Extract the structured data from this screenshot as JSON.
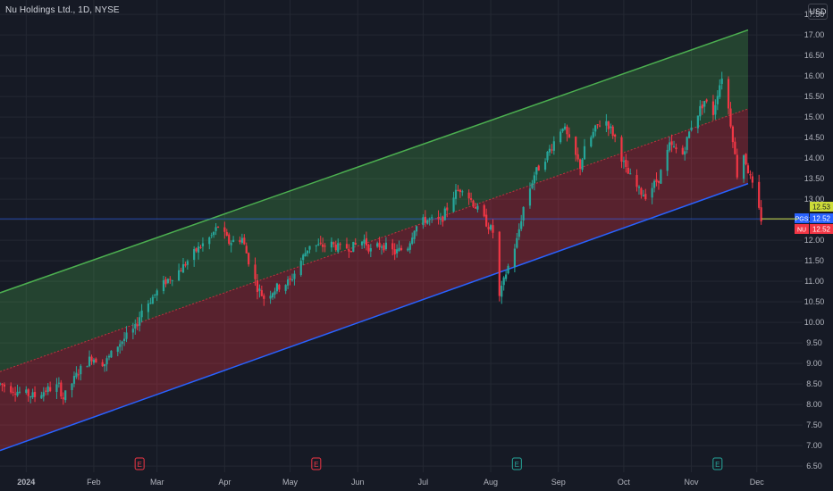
{
  "header": {
    "title": "Nu Holdings Ltd., 1D, NYSE",
    "currency": "USD"
  },
  "chart_data": {
    "type": "candlestick",
    "y_ticks": [
      "6.50",
      "7.00",
      "7.50",
      "8.00",
      "8.50",
      "9.00",
      "9.50",
      "10.00",
      "10.50",
      "11.00",
      "11.50",
      "12.00",
      "12.50",
      "13.00",
      "13.50",
      "14.00",
      "14.50",
      "15.00",
      "15.50",
      "16.00",
      "16.50",
      "17.00",
      "17.50"
    ],
    "ylim": [
      6.35,
      17.85
    ],
    "x_labels": [
      "2024",
      "Feb",
      "Mar",
      "Apr",
      "May",
      "Jun",
      "Jul",
      "Aug",
      "Sep",
      "Oct",
      "Nov",
      "Dec"
    ],
    "x_label_dates": [
      "2024-01-01",
      "2024-02-01",
      "2024-03-01",
      "2024-04-01",
      "2024-05-01",
      "2024-06-01",
      "2024-07-01",
      "2024-08-01",
      "2024-09-01",
      "2024-10-01",
      "2024-11-01",
      "2024-12-01"
    ],
    "xlim": [
      "2023-12-20",
      "2024-12-22"
    ],
    "regression_channel": {
      "start": "2023-12-20",
      "end": "2024-11-27",
      "upper": [
        10.72,
        17.12
      ],
      "middle": [
        8.8,
        15.2
      ],
      "lower": [
        6.88,
        13.38
      ]
    },
    "close_line_value": 12.52,
    "price_badges": [
      {
        "label": "12.53",
        "value": 12.53,
        "color": "#cddc39"
      },
      {
        "label": "12.52",
        "value": 12.52,
        "color": "#2962ff",
        "tag": "PGS"
      },
      {
        "label": "12.52",
        "value": 12.52,
        "color": "#f23645",
        "tag": "NU"
      }
    ],
    "earnings_dates": [
      "2024-02-22",
      "2024-05-13",
      "2024-08-13",
      "2024-11-13"
    ],
    "earnings_label": "E",
    "path_points": [
      [
        "2023-12-20",
        8.5
      ],
      [
        "2023-12-29",
        8.3
      ],
      [
        "2024-01-05",
        8.2
      ],
      [
        "2024-01-10",
        8.35
      ],
      [
        "2024-01-16",
        8.45
      ],
      [
        "2024-01-18",
        8.15
      ],
      [
        "2024-01-25",
        8.8
      ],
      [
        "2024-01-31",
        9.15
      ],
      [
        "2024-02-06",
        9.0
      ],
      [
        "2024-02-12",
        9.45
      ],
      [
        "2024-02-20",
        9.85
      ],
      [
        "2024-02-23",
        10.3
      ],
      [
        "2024-02-27",
        10.55
      ],
      [
        "2024-03-05",
        11.0
      ],
      [
        "2024-03-12",
        11.3
      ],
      [
        "2024-03-19",
        11.75
      ],
      [
        "2024-03-26",
        12.1
      ],
      [
        "2024-03-29",
        12.35
      ],
      [
        "2024-04-03",
        11.95
      ],
      [
        "2024-04-09",
        12.05
      ],
      [
        "2024-04-12",
        11.5
      ],
      [
        "2024-04-16",
        10.85
      ],
      [
        "2024-04-19",
        10.6
      ],
      [
        "2024-04-25",
        10.85
      ],
      [
        "2024-05-01",
        11.0
      ],
      [
        "2024-05-06",
        11.5
      ],
      [
        "2024-05-10",
        11.9
      ],
      [
        "2024-05-15",
        11.85
      ],
      [
        "2024-05-20",
        11.9
      ],
      [
        "2024-05-24",
        11.8
      ],
      [
        "2024-05-30",
        11.85
      ],
      [
        "2024-06-04",
        12.0
      ],
      [
        "2024-06-07",
        11.75
      ],
      [
        "2024-06-12",
        11.9
      ],
      [
        "2024-06-18",
        11.7
      ],
      [
        "2024-06-24",
        11.85
      ],
      [
        "2024-06-27",
        12.3
      ],
      [
        "2024-07-02",
        12.5
      ],
      [
        "2024-07-09",
        12.45
      ],
      [
        "2024-07-15",
        13.1
      ],
      [
        "2024-07-19",
        13.3
      ],
      [
        "2024-07-24",
        12.9
      ],
      [
        "2024-07-29",
        12.5
      ],
      [
        "2024-08-02",
        12.2
      ],
      [
        "2024-08-05",
        10.6
      ],
      [
        "2024-08-08",
        11.2
      ],
      [
        "2024-08-13",
        12.0
      ],
      [
        "2024-08-16",
        12.8
      ],
      [
        "2024-08-21",
        13.6
      ],
      [
        "2024-08-27",
        14.1
      ],
      [
        "2024-09-03",
        14.8
      ],
      [
        "2024-09-06",
        14.4
      ],
      [
        "2024-09-11",
        13.8
      ],
      [
        "2024-09-13",
        14.2
      ],
      [
        "2024-09-19",
        14.8
      ],
      [
        "2024-09-23",
        14.9
      ],
      [
        "2024-09-27",
        14.5
      ],
      [
        "2024-10-02",
        13.7
      ],
      [
        "2024-10-08",
        13.2
      ],
      [
        "2024-10-11",
        13.1
      ],
      [
        "2024-10-17",
        13.5
      ],
      [
        "2024-10-22",
        14.3
      ],
      [
        "2024-10-28",
        14.1
      ],
      [
        "2024-11-01",
        14.8
      ],
      [
        "2024-11-07",
        15.4
      ],
      [
        "2024-11-11",
        15.1
      ],
      [
        "2024-11-13",
        15.6
      ],
      [
        "2024-11-15",
        16.0
      ],
      [
        "2024-11-18",
        15.2
      ],
      [
        "2024-11-20",
        14.5
      ],
      [
        "2024-11-22",
        13.6
      ],
      [
        "2024-11-25",
        14.1
      ],
      [
        "2024-11-27",
        13.7
      ],
      [
        "2024-12-03",
        12.52
      ]
    ]
  },
  "colors": {
    "background": "#161a25",
    "grid": "#242833",
    "up": "#26a69a",
    "down": "#f23645",
    "channel_upper": "#4caf50",
    "channel_lower": "#2962ff",
    "channel_mid": "#f23645",
    "upper_fill": "rgba(76,175,80,0.28)",
    "lower_fill": "rgba(242,54,69,0.30)",
    "text": "#b2b5be",
    "close_line": "#2962ff"
  }
}
